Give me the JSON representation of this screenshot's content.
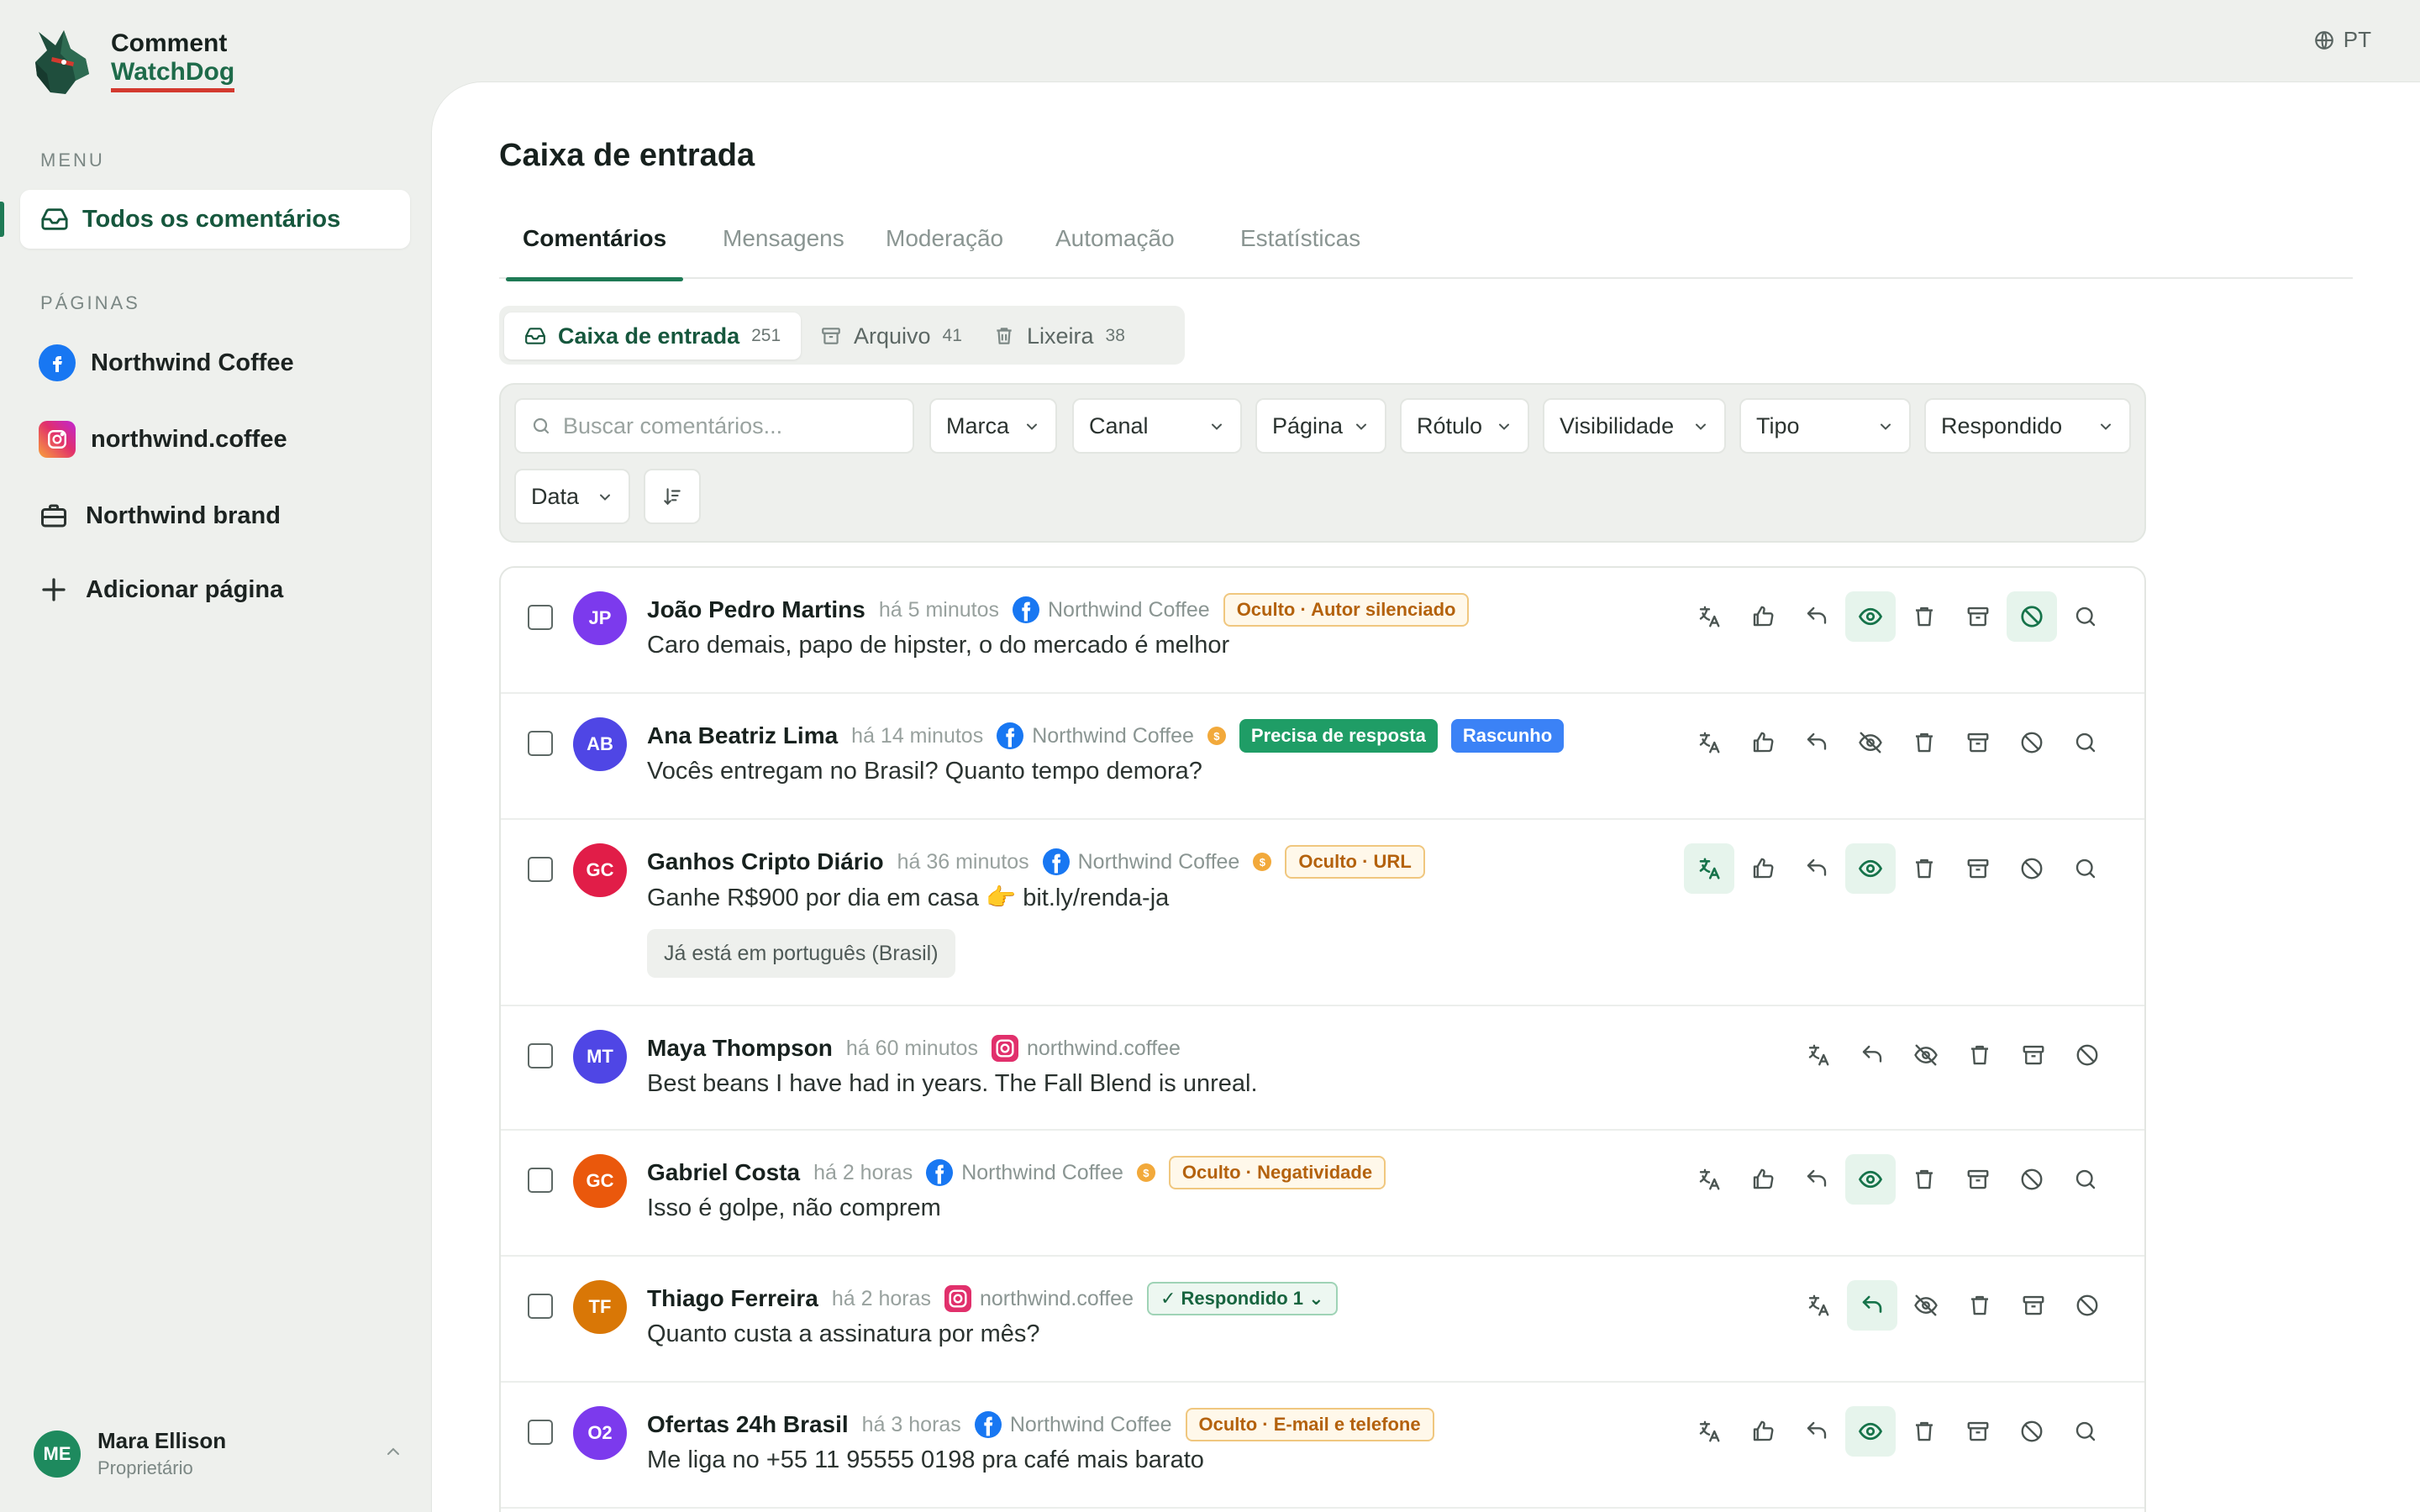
{
  "app": {
    "name_line1": "Comment",
    "name_line2": "WatchDog",
    "language": "PT"
  },
  "sidebar": {
    "menu_heading": "MENU",
    "active_item": "Todos os comentários",
    "pages_heading": "PÁGINAS",
    "pages": [
      {
        "label": "Northwind Coffee",
        "icon": "facebook-icon"
      },
      {
        "label": "northwind.coffee",
        "icon": "instagram-icon"
      },
      {
        "label": "Northwind brand",
        "icon": "briefcase-icon"
      }
    ],
    "add_page": "Adicionar página",
    "user": {
      "initials": "ME",
      "name": "Mara Ellison",
      "role": "Proprietário"
    }
  },
  "main": {
    "title": "Caixa de entrada",
    "tabs": [
      "Comentários",
      "Mensagens",
      "Moderação",
      "Automação",
      "Estatísticas"
    ],
    "active_tab": "Comentários",
    "segments": [
      {
        "label": "Caixa de entrada",
        "count": "251"
      },
      {
        "label": "Arquivo",
        "count": "41"
      },
      {
        "label": "Lixeira",
        "count": "38"
      }
    ],
    "filters": {
      "search_placeholder": "Buscar comentários...",
      "marca": "Marca",
      "canal": "Canal",
      "pagina": "Página",
      "rotulo": "Rótulo",
      "visibilidade": "Visibilidade",
      "tipo": "Tipo",
      "respondido": "Respondido",
      "data": "Data"
    },
    "comments": [
      {
        "initials": "JP",
        "name": "João Pedro Martins",
        "time": "há 5 minutos",
        "channel": "facebook",
        "page": "Northwind Coffee",
        "coin": false,
        "badges": [
          {
            "text": "Oculto · Autor silenciado",
            "kind": "warn"
          }
        ],
        "text": "Caro demais, papo de hipster, o do mercado é melhor",
        "translation": "",
        "color": "#7c3aed"
      },
      {
        "initials": "AB",
        "name": "Ana Beatriz Lima",
        "time": "há 14 minutos",
        "channel": "facebook",
        "page": "Northwind Coffee",
        "coin": true,
        "badges": [
          {
            "text": "Precisa de resposta",
            "kind": "green"
          },
          {
            "text": "Rascunho",
            "kind": "blue"
          }
        ],
        "text": "Vocês entregam no Brasil? Quanto tempo demora?",
        "translation": "",
        "color": "#4f46e5"
      },
      {
        "initials": "GC",
        "name": "Ganhos Cripto Diário",
        "time": "há 36 minutos",
        "channel": "facebook",
        "page": "Northwind Coffee",
        "coin": true,
        "badges": [
          {
            "text": "Oculto · URL",
            "kind": "warn"
          }
        ],
        "text": "Ganhe R$900 por dia em casa 👉 bit.ly/renda-ja",
        "translation": "Já está em português (Brasil)",
        "color": "#e11d48"
      },
      {
        "initials": "MT",
        "name": "Maya Thompson",
        "time": "há 60 minutos",
        "channel": "instagram",
        "page": "northwind.coffee",
        "coin": false,
        "badges": [],
        "text": "Best beans I have had in years. The Fall Blend is unreal.",
        "translation": "",
        "color": "#4f46e5"
      },
      {
        "initials": "GC",
        "name": "Gabriel Costa",
        "time": "há 2 horas",
        "channel": "facebook",
        "page": "Northwind Coffee",
        "coin": true,
        "badges": [
          {
            "text": "Oculto · Negatividade",
            "kind": "warn"
          }
        ],
        "text": "Isso é golpe, não comprem",
        "translation": "",
        "color": "#ea580c"
      },
      {
        "initials": "TF",
        "name": "Thiago Ferreira",
        "time": "há 2 horas",
        "channel": "instagram",
        "page": "northwind.coffee",
        "coin": false,
        "badges": [
          {
            "text": "✓ Respondido 1 ⌄",
            "kind": "answered"
          }
        ],
        "text": "Quanto custa a assinatura por mês?",
        "translation": "",
        "color": "#d97706"
      },
      {
        "initials": "O2",
        "name": "Ofertas 24h Brasil",
        "time": "há 3 horas",
        "channel": "facebook",
        "page": "Northwind Coffee",
        "coin": false,
        "badges": [
          {
            "text": "Oculto · E-mail e telefone",
            "kind": "warn"
          }
        ],
        "text": "Me liga no +55 11 95555 0198 pra café mais barato",
        "translation": "",
        "color": "#7c3aed"
      }
    ]
  },
  "colors": {
    "accent": "#1e7a55",
    "warn": "#b4620d",
    "facebook": "#1877f2"
  }
}
